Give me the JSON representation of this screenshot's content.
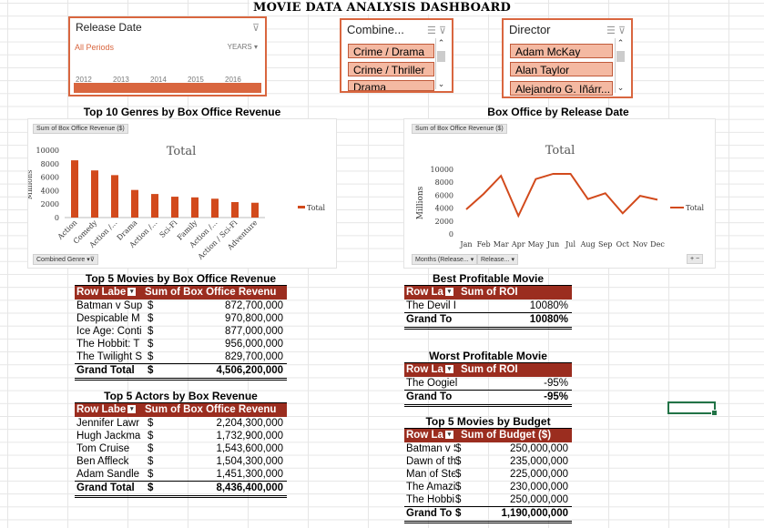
{
  "dashboard_title": "MOVIE DATA ANALYSIS DASHBOARD",
  "slicers": {
    "release_date": {
      "title": "Release Date",
      "period_label": "All Periods",
      "unit_label": "YEARS",
      "years": [
        "2012",
        "2013",
        "2014",
        "2015",
        "2016"
      ]
    },
    "combined_genre": {
      "title": "Combine...",
      "items": [
        "Crime / Drama",
        "Crime / Thriller",
        "Drama"
      ]
    },
    "director": {
      "title": "Director",
      "items": [
        "Adam McKay",
        "Alan Taylor",
        "Alejandro G. Iñárr..."
      ]
    }
  },
  "chart_data": [
    {
      "type": "bar",
      "title": "Top 10 Genres by Box Office Revenue",
      "inner_title": "Total",
      "field_button": "Sum of Box Office Revenue ($)",
      "axis_button": "Combined Genre",
      "ylabel": "Millions",
      "legend": "Total",
      "categories": [
        "Action",
        "Comedy",
        "Action /...",
        "Drama",
        "Action /...",
        "Sci-Fi",
        "Family",
        "Action /...",
        "Action / Sci-Fi",
        "Adventure"
      ],
      "series": [
        {
          "name": "Total",
          "values": [
            8500,
            7000,
            6300,
            4100,
            3500,
            3100,
            3000,
            2800,
            2300,
            2200
          ]
        }
      ],
      "ylim": [
        0,
        10000
      ],
      "yticks": [
        "0",
        "2000",
        "4000",
        "6000",
        "8000",
        "10000"
      ],
      "color": "#d24a1c"
    },
    {
      "type": "line",
      "title": "Box Office by Release Date",
      "inner_title": "Total",
      "field_button": "Sum of Box Office Revenue ($)",
      "axis_buttons": [
        "Months (Release...",
        "Release..."
      ],
      "ylabel": "Millions",
      "legend": "Total",
      "categories": [
        "Jan",
        "Feb",
        "Mar",
        "Apr",
        "May",
        "Jun",
        "Jul",
        "Aug",
        "Sep",
        "Oct",
        "Nov",
        "Dec"
      ],
      "series": [
        {
          "name": "Total",
          "values": [
            3800,
            6200,
            9000,
            2800,
            8500,
            9300,
            9300,
            5400,
            6300,
            3200,
            5900,
            5300
          ]
        }
      ],
      "ylim": [
        0,
        10000
      ],
      "yticks": [
        "0",
        "2000",
        "4000",
        "6000",
        "8000",
        "10000"
      ],
      "color": "#d24a1c"
    }
  ],
  "tables": {
    "top5_movies_revenue": {
      "title": "Top 5 Movies by Box Office Revenue",
      "headers": [
        "Row Labe",
        "Sum of Box Office Revenu"
      ],
      "rows": [
        {
          "label": "Batman v Sup",
          "cur": "$",
          "value": "872,700,000"
        },
        {
          "label": "Despicable M",
          "cur": "$",
          "value": "970,800,000"
        },
        {
          "label": "Ice Age: Conti",
          "cur": "$",
          "value": "877,000,000"
        },
        {
          "label": "The Hobbit: T",
          "cur": "$",
          "value": "956,000,000"
        },
        {
          "label": "The Twilight S",
          "cur": "$",
          "value": "829,700,000"
        }
      ],
      "total": {
        "label": "Grand Total",
        "cur": "$",
        "value": "4,506,200,000"
      }
    },
    "top5_actors": {
      "title": "Top 5 Actors by Box Revenue",
      "headers": [
        "Row Labe",
        "Sum of Box Office Revenu"
      ],
      "rows": [
        {
          "label": "Jennifer Lawr",
          "cur": "$",
          "value": "2,204,300,000"
        },
        {
          "label": "Hugh Jackma",
          "cur": "$",
          "value": "1,732,900,000"
        },
        {
          "label": "Tom Cruise",
          "cur": "$",
          "value": "1,543,600,000"
        },
        {
          "label": "Ben Affleck",
          "cur": "$",
          "value": "1,504,300,000"
        },
        {
          "label": "Adam Sandle",
          "cur": "$",
          "value": "1,451,300,000"
        }
      ],
      "total": {
        "label": "Grand Total",
        "cur": "$",
        "value": "8,436,400,000"
      }
    },
    "best_profitable": {
      "title": "Best Profitable Movie",
      "headers": [
        "Row La",
        "Sum of ROI"
      ],
      "rows": [
        {
          "label": "The Devil I",
          "value": "10080%"
        }
      ],
      "total": {
        "label": "Grand To",
        "value": "10080%"
      }
    },
    "worst_profitable": {
      "title": "Worst Profitable Movie",
      "headers": [
        "Row La",
        "Sum of ROI"
      ],
      "rows": [
        {
          "label": "The Oogiel",
          "value": "-95%"
        }
      ],
      "total": {
        "label": "Grand To",
        "value": "-95%"
      }
    },
    "top5_budget": {
      "title": "Top 5 Movies by Budget",
      "headers": [
        "Row La",
        "Sum of Budget ($)"
      ],
      "rows": [
        {
          "label": "Batman v S",
          "cur": "$",
          "value": "250,000,000"
        },
        {
          "label": "Dawn of th",
          "cur": "$",
          "value": "235,000,000"
        },
        {
          "label": "Man of Ste",
          "cur": "$",
          "value": "225,000,000"
        },
        {
          "label": "The Amazi",
          "cur": "$",
          "value": "230,000,000"
        },
        {
          "label": "The Hobbi",
          "cur": "$",
          "value": "250,000,000"
        }
      ],
      "total": {
        "label": "Grand To",
        "cur": "$",
        "value": "1,190,000,000"
      }
    }
  }
}
